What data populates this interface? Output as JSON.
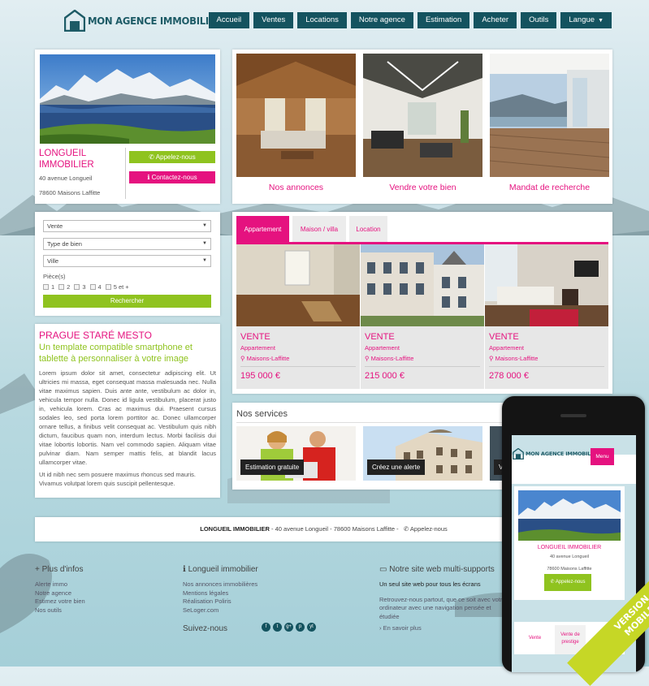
{
  "brand": {
    "name": "MON AGENCE IMMOBILIÈRE",
    "accent": "#e5127f",
    "green": "#8fc31f",
    "teal": "#14535f"
  },
  "nav": {
    "items": [
      "Accueil",
      "Ventes",
      "Locations",
      "Notre agence",
      "Estimation",
      "Acheter",
      "Outils",
      "Langue"
    ]
  },
  "agency": {
    "name": "LONGUEIL IMMOBILIER",
    "address1": "40 avenue Longueil",
    "address2": "78600 Maisons Laffitte",
    "call_label": "Appelez-nous",
    "contact_label": "Contactez-nous"
  },
  "categories": [
    {
      "label": "Nos annonces"
    },
    {
      "label": "Vendre votre bien"
    },
    {
      "label": "Mandat de recherche"
    }
  ],
  "search": {
    "vente": "Vente",
    "type": "Type de bien",
    "ville": "Ville",
    "pieces_label": "Pièce(s)",
    "pieces": [
      "1",
      "2",
      "3",
      "4",
      "5 et +"
    ],
    "button": "Rechercher"
  },
  "tabs": [
    "Appartement",
    "Maison / villa",
    "Location"
  ],
  "listings": [
    {
      "type": "VENTE",
      "sub": "Appartement",
      "loc": "Maisons-Laffitte",
      "price": "195 000 €"
    },
    {
      "type": "VENTE",
      "sub": "Appartement",
      "loc": "Maisons-Laffitte",
      "price": "215 000 €"
    },
    {
      "type": "VENTE",
      "sub": "Appartement",
      "loc": "Maisons-Laffitte",
      "price": "278 000 €"
    }
  ],
  "article": {
    "title": "PRAGUE STARÉ MESTO",
    "subtitle": "Un template compatible smartphone et tablette à personnaliser à votre image",
    "body": "Lorem ipsum dolor sit amet, consectetur adipiscing elit. Ut ultricies mi massa, eget consequat massa malesuada nec. Nulla vitae maximus sapien. Duis ante ante, vestibulum ac dolor in, vehicula tempor nulla. Donec id ligula vestibulum, placerat justo in, vehicula lorem. Cras ac maximus dui. Praesent cursus sodales leo, sed porta lorem porttitor ac. Donec ullamcorper ornare tellus, a finibus velit consequat ac. Vestibulum quis nibh dictum, faucibus quam non, interdum lectus. Morbi facilisis dui vitae lobortis lobortis. Nam vel commodo sapien. Aliquam vitae pulvinar diam. Nam semper mattis felis, at blandit lacus ullamcorper vitae.",
    "body2": "Ut id nibh nec sem posuere maximus rhoncus sed mauris. Vivamus volutpat lorem quis suscipit pellentesque."
  },
  "services": {
    "title": "Nos services",
    "items": [
      "Estimation gratuite",
      "Créez une alerte",
      "Ve"
    ]
  },
  "address_bar": {
    "name": "LONGUEIL IMMOBILIER",
    "rest": " - 40 avenue Longueil - 78600 Maisons Laffitte -",
    "call": "Appelez-nous"
  },
  "footer": {
    "col1": {
      "title": "Plus d'infos",
      "links": [
        "Alerte immo",
        "Notre agence",
        "Estimez votre bien",
        "Nos outils"
      ]
    },
    "col2": {
      "title": "Longueil immobilier",
      "links": [
        "Nos annonces immobilières",
        "Mentions légales",
        "Réalisation Poliris",
        "SeLoger.com"
      ],
      "follow": "Suivez-nous"
    },
    "col3": {
      "title": "Notre site web multi-supports",
      "lead": "Un seul site web pour tous les écrans",
      "text": "Retrouvez-nous partout, que ce soit avec votre ordinateur avec une navigation pensée et étudiée",
      "more": "En savoir plus"
    },
    "social": [
      "f",
      "t",
      "g+",
      "p",
      "yt"
    ]
  },
  "phone": {
    "logo": "MON AGENCE IMMOBILIÈRE",
    "menu": "Menu",
    "name": "LONGUEIL IMMOBILIER",
    "address1": "40 avenue Longueil",
    "address2": "78600 Maisons Laffitte",
    "call": "Appelez-nous",
    "tab1": "Vente",
    "tab2": "Vente de prestige"
  },
  "ribbon": {
    "line1": "VERSION",
    "line2": "MOBILE"
  }
}
